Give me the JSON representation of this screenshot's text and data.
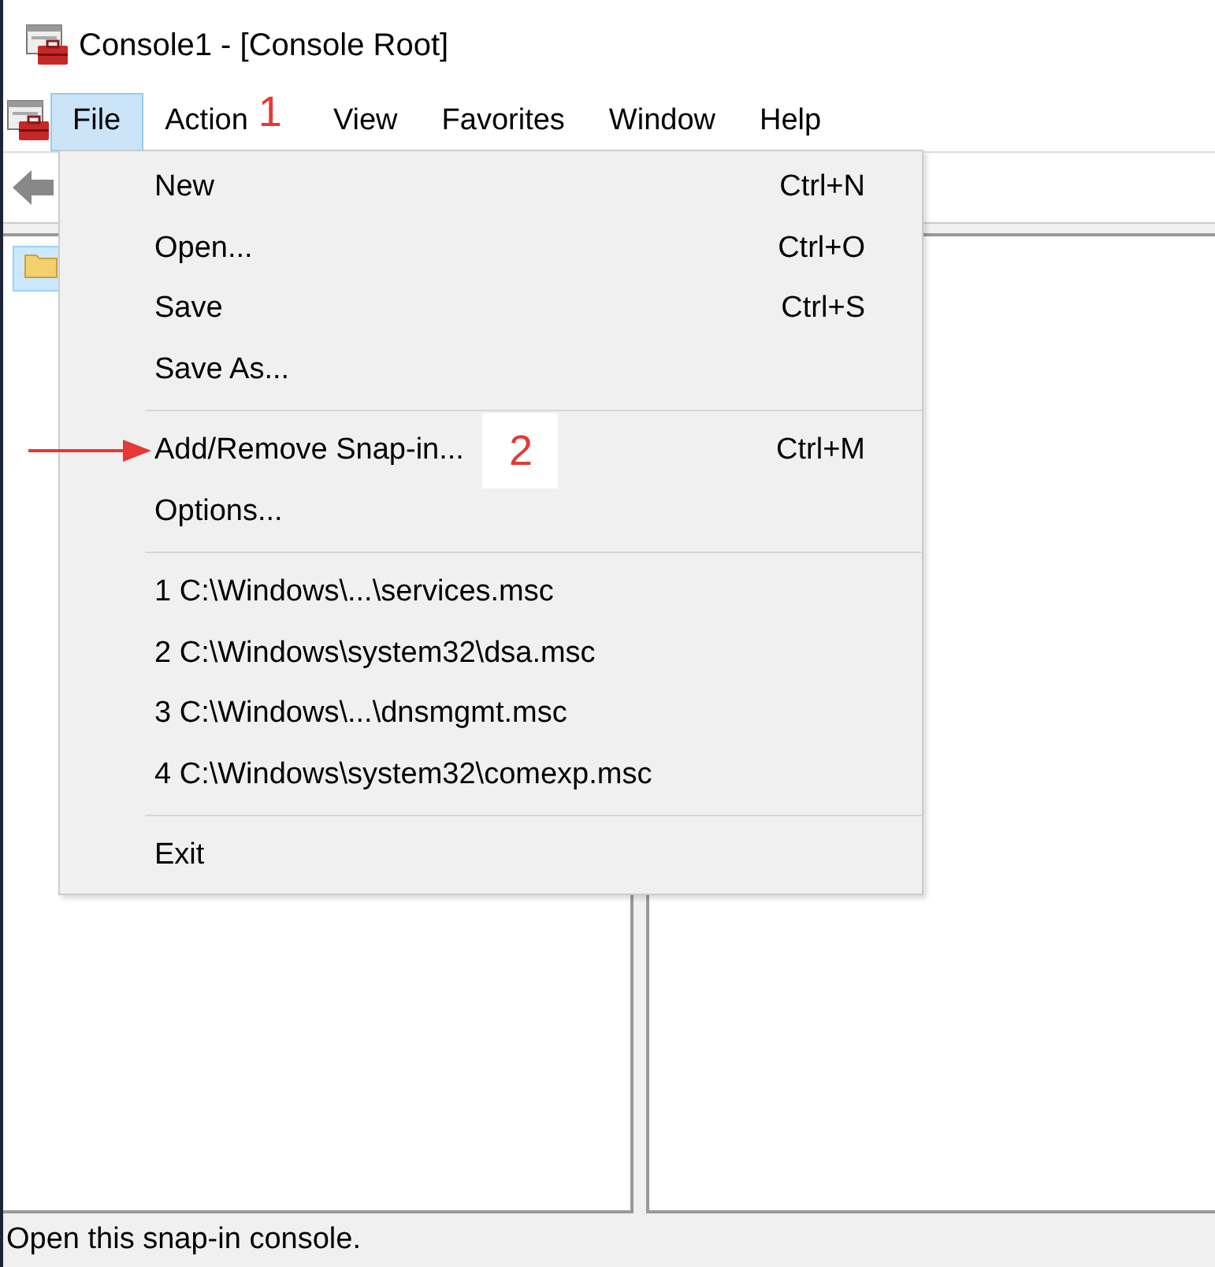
{
  "window": {
    "title": "Console1 - [Console Root]"
  },
  "menu_bar": [
    {
      "label": "File",
      "selected": true
    },
    {
      "label": "Action",
      "selected": false,
      "callout": "1"
    },
    {
      "label": "View",
      "selected": false
    },
    {
      "label": "Favorites",
      "selected": false
    },
    {
      "label": "Window",
      "selected": false
    },
    {
      "label": "Help",
      "selected": false
    }
  ],
  "tree": {
    "items": [
      {
        "selected": true
      }
    ]
  },
  "file_menu": [
    {
      "kind": "item",
      "label": "New",
      "shortcut": "Ctrl+N"
    },
    {
      "kind": "item",
      "label": "Open...",
      "shortcut": "Ctrl+O"
    },
    {
      "kind": "item",
      "label": "Save",
      "shortcut": "Ctrl+S"
    },
    {
      "kind": "item",
      "label": "Save As..."
    },
    {
      "kind": "separator"
    },
    {
      "kind": "item",
      "label": "Add/Remove Snap-in...",
      "shortcut": "Ctrl+M",
      "callout": "2",
      "arrow": true
    },
    {
      "kind": "item",
      "label": "Options..."
    },
    {
      "kind": "separator"
    },
    {
      "kind": "item",
      "label": "1 C:\\Windows\\...\\services.msc"
    },
    {
      "kind": "item",
      "label": "2 C:\\Windows\\system32\\dsa.msc"
    },
    {
      "kind": "item",
      "label": "3 C:\\Windows\\...\\dnsmgmt.msc"
    },
    {
      "kind": "item",
      "label": "4 C:\\Windows\\system32\\comexp.msc"
    },
    {
      "kind": "separator"
    },
    {
      "kind": "item",
      "label": "Exit"
    }
  ],
  "status_bar": {
    "text": "Open this snap-in console."
  }
}
